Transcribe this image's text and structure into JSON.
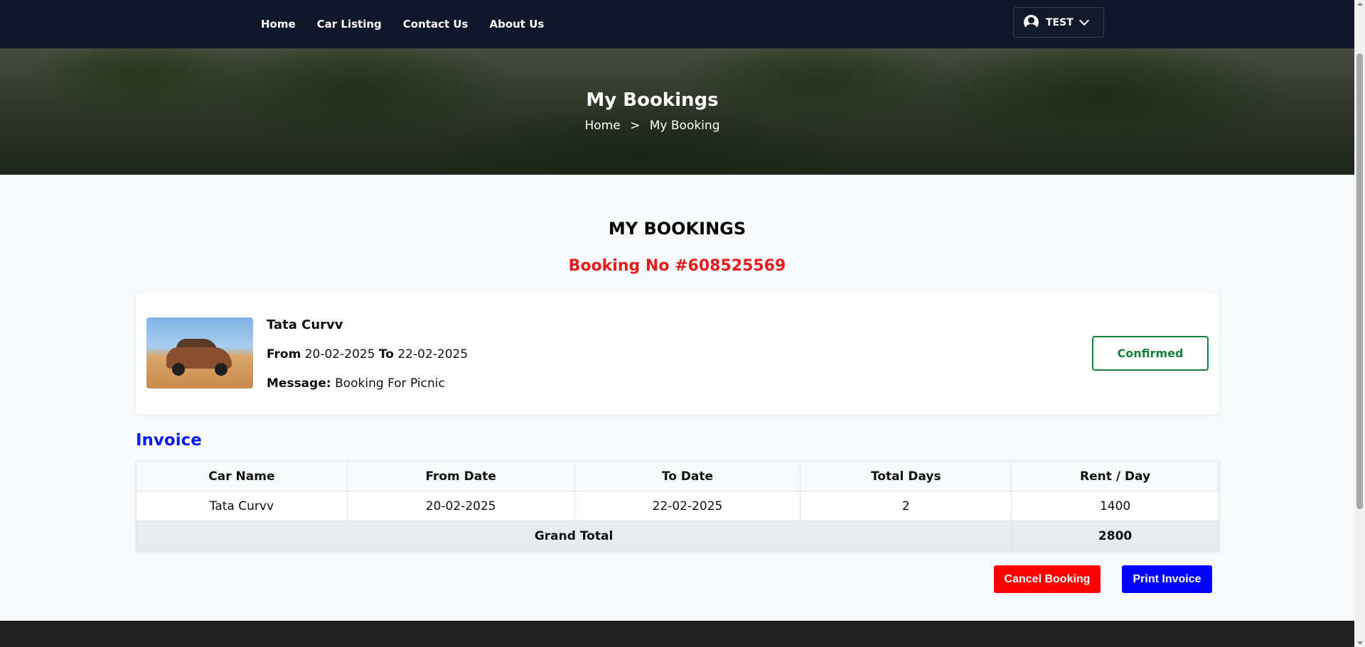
{
  "nav": {
    "links": [
      "Home",
      "Car Listing",
      "Contact Us",
      "About Us"
    ],
    "user": {
      "name": "TEST",
      "icon": "user-circle-icon",
      "dropdown_icon": "chevron-down-icon"
    }
  },
  "hero": {
    "title": "My Bookings",
    "breadcrumb": {
      "home": "Home",
      "separator": ">",
      "current": "My Booking"
    }
  },
  "main": {
    "title": "MY BOOKINGS",
    "booking_no": "Booking No #608525569"
  },
  "booking": {
    "car_name": "Tata Curvv",
    "from_label": "From",
    "from_date": "20-02-2025",
    "to_label": "To",
    "to_date": "22-02-2025",
    "message_label": "Message:",
    "message": "Booking For Picnic",
    "status": "Confirmed"
  },
  "invoice": {
    "title": "Invoice",
    "headers": [
      "Car Name",
      "From Date",
      "To Date",
      "Total Days",
      "Rent / Day"
    ],
    "rows": [
      [
        "Tata Curvv",
        "20-02-2025",
        "22-02-2025",
        "2",
        "1400"
      ]
    ],
    "grand_total_label": "Grand Total",
    "grand_total_value": "2800"
  },
  "actions": {
    "cancel_label": "Cancel Booking",
    "print_label": "Print Invoice"
  },
  "colors": {
    "navbar": "#0f172a",
    "booking_no": "#e11d1d",
    "invoice_title": "#0b1ee6",
    "status": "#15803d",
    "cancel_button": "#ff0000",
    "print_button": "#0000ff",
    "footer": "#212121"
  }
}
